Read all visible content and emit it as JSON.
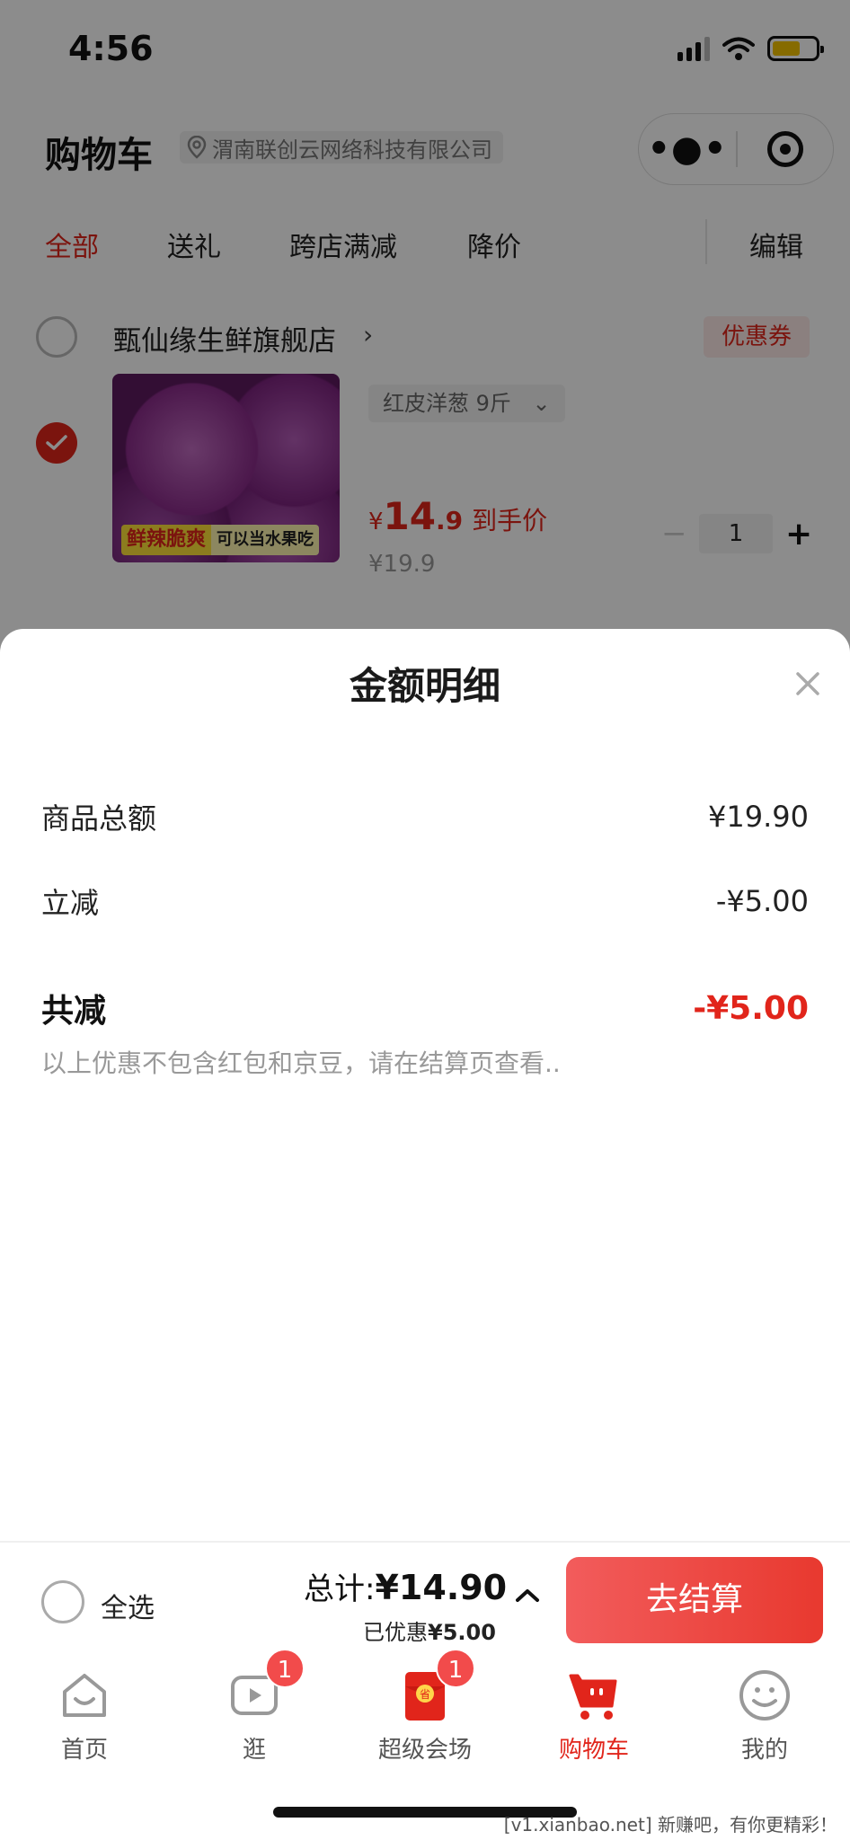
{
  "status_bar": {
    "time": "4:56"
  },
  "nav": {
    "title": "购物车",
    "location": "渭南联创云网络科技有限公司"
  },
  "tabs": [
    {
      "label": "全部",
      "active": true
    },
    {
      "label": "送礼"
    },
    {
      "label": "跨店满减"
    },
    {
      "label": "降价"
    }
  ],
  "edit_label": "编辑",
  "shop": {
    "name": "甄仙缘生鲜旗舰店",
    "coupon": "优惠券"
  },
  "product": {
    "image_banner_1": "鲜辣脆爽",
    "image_banner_2": "可以当水果吃",
    "spec": "红皮洋葱 9斤",
    "price_currency": "¥",
    "price_int": "14",
    "price_dec": ".9",
    "price_tag": "到手价",
    "orig_price": "¥19.9",
    "quantity": "1"
  },
  "sheet": {
    "title": "金额明细",
    "rows": [
      {
        "label": "商品总额",
        "value": "¥19.90"
      },
      {
        "label": "立减",
        "value": "-¥5.00"
      }
    ],
    "total": {
      "label": "共减",
      "value": "-¥5.00"
    },
    "note": "以上优惠不包含红包和京豆，请在结算页查看.."
  },
  "checkout": {
    "select_all": "全选",
    "total_label": "总计:",
    "total_amount": "¥14.90",
    "saved_label": "已优惠",
    "saved_amount": "¥5.00",
    "button": "去结算"
  },
  "tabbar": [
    {
      "label": "首页",
      "icon": "home-icon"
    },
    {
      "label": "逛",
      "icon": "video-icon",
      "badge": "1"
    },
    {
      "label": "超级会场",
      "icon": "red-envelope-icon",
      "badge": "1"
    },
    {
      "label": "购物车",
      "icon": "cart-icon",
      "active": true
    },
    {
      "label": "我的",
      "icon": "profile-icon"
    }
  ],
  "watermark": "[v1.xianbao.net] 新赚吧，有你更精彩！",
  "colors": {
    "accent": "#e1251b",
    "checkout_button": "#ec4437"
  }
}
